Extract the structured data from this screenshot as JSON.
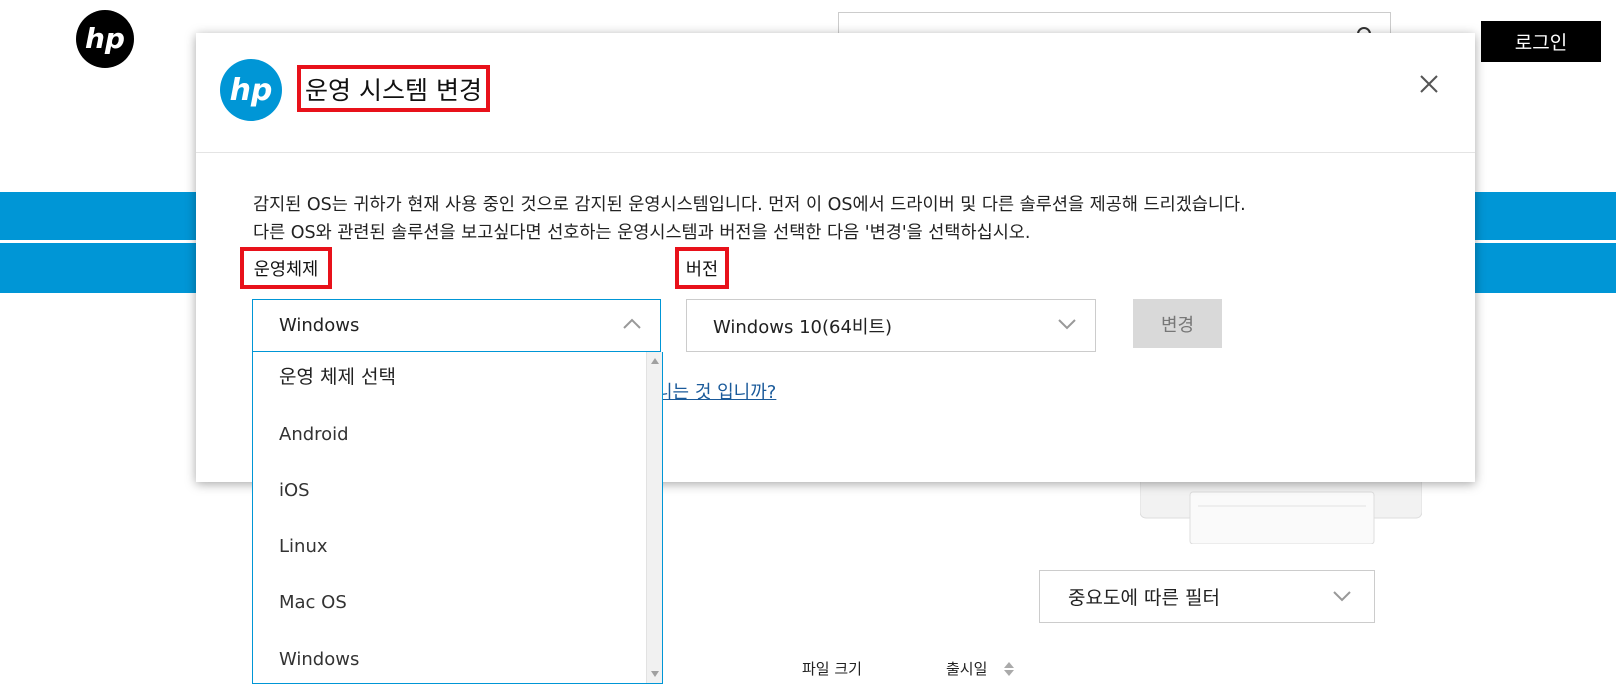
{
  "header": {
    "nav_fragment": "",
    "login_label": "로그인"
  },
  "modal": {
    "title": "운영 시스템 변경",
    "description_line1": "감지된 OS는 귀하가 현재 사용 중인 것으로 감지된 운영시스템입니다. 먼저 이 OS에서 드라이버 및 다른 솔루션을 제공해 드리겠습니다.",
    "description_line2": "다른 OS와 관련된 솔루션을 보고싶다면 선호하는 운영시스템과 버전을 선택한 다음 '변경'을 선택하십시오.",
    "os_label": "운영체제",
    "version_label": "버전",
    "os_selected": "Windows",
    "version_selected": "Windows 10(64비트)",
    "change_button": "변경",
    "link_fragment": "니는 것 입니까?"
  },
  "os_dropdown": {
    "placeholder": "운영 체제 선택",
    "options": [
      "Android",
      "iOS",
      "Linux",
      "Mac OS",
      "Windows"
    ]
  },
  "page": {
    "filter_label": "중요도에 따른 필터",
    "col_file_size": "파일 크기",
    "col_release_date": "출시일"
  },
  "colors": {
    "brand_blue": "#0096d6",
    "highlight_red": "#e8111a",
    "button_disabled": "#d9d9d9"
  },
  "icons": {
    "logo": "hp-logo-icon",
    "close": "close-icon",
    "chevron_up": "chevron-up-icon",
    "chevron_down": "chevron-down-icon",
    "search": "search-icon",
    "sort": "sort-icon"
  }
}
